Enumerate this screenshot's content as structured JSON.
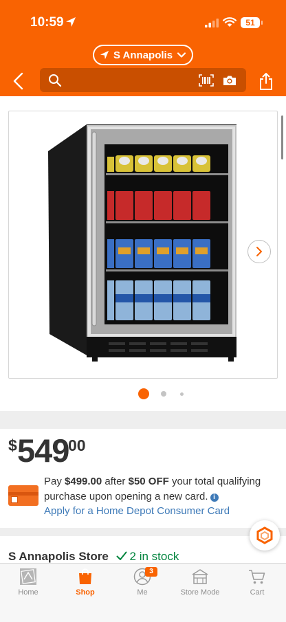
{
  "status_bar": {
    "time": "10:59",
    "battery": "51"
  },
  "header": {
    "store_selector": "S Annapolis",
    "search_placeholder": ""
  },
  "gallery": {
    "image_count": 3,
    "active_index": 0
  },
  "price": {
    "dollar_sign": "$",
    "whole": "549",
    "cents": "00"
  },
  "card_offer": {
    "pay_prefix": "Pay ",
    "pay_amount": "$499.00",
    "after_text": " after ",
    "discount": "$50 OFF",
    "rest_text": " your total qualifying purchase upon opening a new card.",
    "apply_link": "Apply for a Home Depot Consumer Card"
  },
  "store_availability": {
    "store_name": "S Annapolis Store",
    "stock_text": "2 in stock"
  },
  "tabbar": {
    "tabs": [
      {
        "label": "Home",
        "icon": "home-depot-logo-icon"
      },
      {
        "label": "Shop",
        "icon": "shopping-bag-icon"
      },
      {
        "label": "Me",
        "icon": "person-icon",
        "badge": "3"
      },
      {
        "label": "Store Mode",
        "icon": "store-icon"
      },
      {
        "label": "Cart",
        "icon": "cart-icon"
      }
    ],
    "active_tab": "Shop"
  },
  "colors": {
    "brand": "#f96302",
    "link": "#3e7ab8",
    "in_stock": "#00843d"
  }
}
